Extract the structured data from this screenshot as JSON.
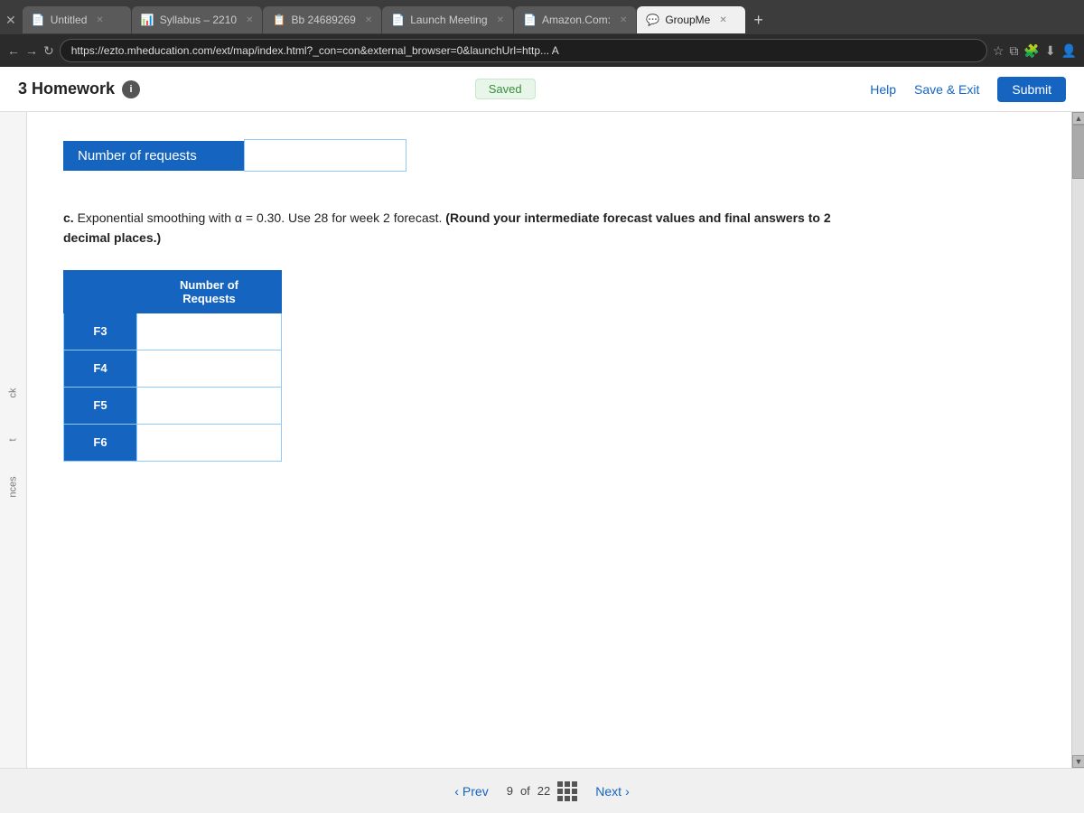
{
  "browser": {
    "tabs": [
      {
        "id": "untitled",
        "label": "Untitled",
        "icon": "📄",
        "active": false
      },
      {
        "id": "syllabus",
        "label": "Syllabus – 2210",
        "icon": "📊",
        "active": false
      },
      {
        "id": "bb",
        "label": "Bb 24689269",
        "icon": "📋",
        "active": false
      },
      {
        "id": "launch",
        "label": "Launch Meeting",
        "icon": "📄",
        "active": false
      },
      {
        "id": "amazon",
        "label": "Amazon.Com:",
        "icon": "📄",
        "active": false
      },
      {
        "id": "groupme",
        "label": "GroupMe",
        "icon": "💬",
        "active": true
      }
    ],
    "address_bar": "https://ezto.mheducation.com/ext/map/index.html?_con=con&external_browser=0&launchUrl=http... A"
  },
  "header": {
    "title": "3 Homework",
    "saved_label": "Saved",
    "help_label": "Help",
    "save_exit_label": "Save & Exit",
    "submit_label": "Submit"
  },
  "content": {
    "section_label": "Number of requests",
    "problem": {
      "prefix": "c.",
      "text": " Exponential smoothing with α = 0.30. Use 28 for week 2 forecast.",
      "bold_text": " (Round your intermediate forecast values and final answers to 2 decimal places.)"
    },
    "table": {
      "header": "Number of Requests",
      "rows": [
        {
          "label": "F3",
          "value": ""
        },
        {
          "label": "F4",
          "value": ""
        },
        {
          "label": "F5",
          "value": ""
        },
        {
          "label": "F6",
          "value": ""
        }
      ]
    }
  },
  "bottom_nav": {
    "prev_label": "Prev",
    "page_current": "9",
    "page_separator": "of",
    "page_total": "22",
    "next_label": "Next"
  },
  "sidebar_labels": {
    "ck": "ck",
    "t": "t",
    "nces": "nces"
  }
}
